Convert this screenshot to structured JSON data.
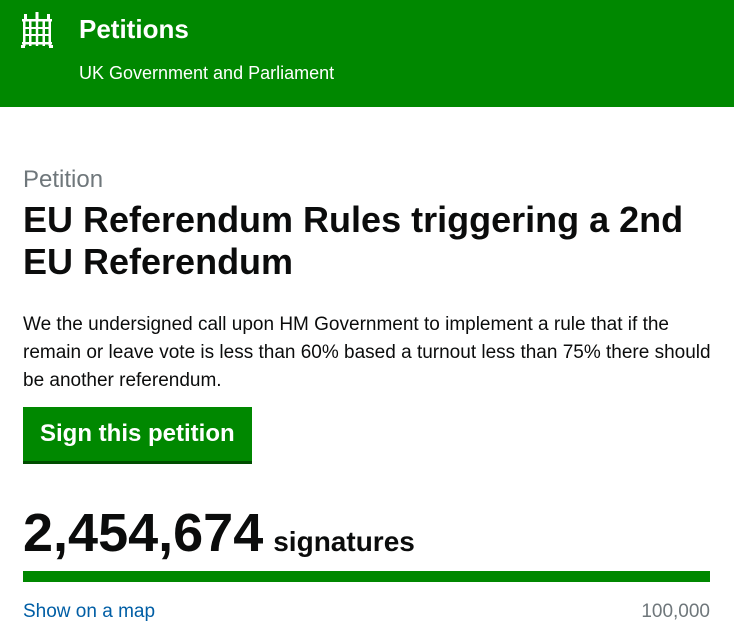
{
  "header": {
    "logo_icon": "portcullis-icon",
    "title": "Petitions",
    "subtitle": "UK Government and Parliament",
    "background_color": "#008800"
  },
  "petition": {
    "kicker": "Petition",
    "title": "EU Referendum Rules triggering a 2nd EU Referendum",
    "description": "We the undersigned call upon HM Government to implement a rule that if the remain or leave vote is less than 60% based a turnout less than 75% there should be another referendum.",
    "sign_button_label": "Sign this petition"
  },
  "signatures": {
    "count": "2,454,674",
    "label": "signatures",
    "progress_fraction": 1.0,
    "map_link_label": "Show on a map",
    "threshold": "100,000"
  }
}
